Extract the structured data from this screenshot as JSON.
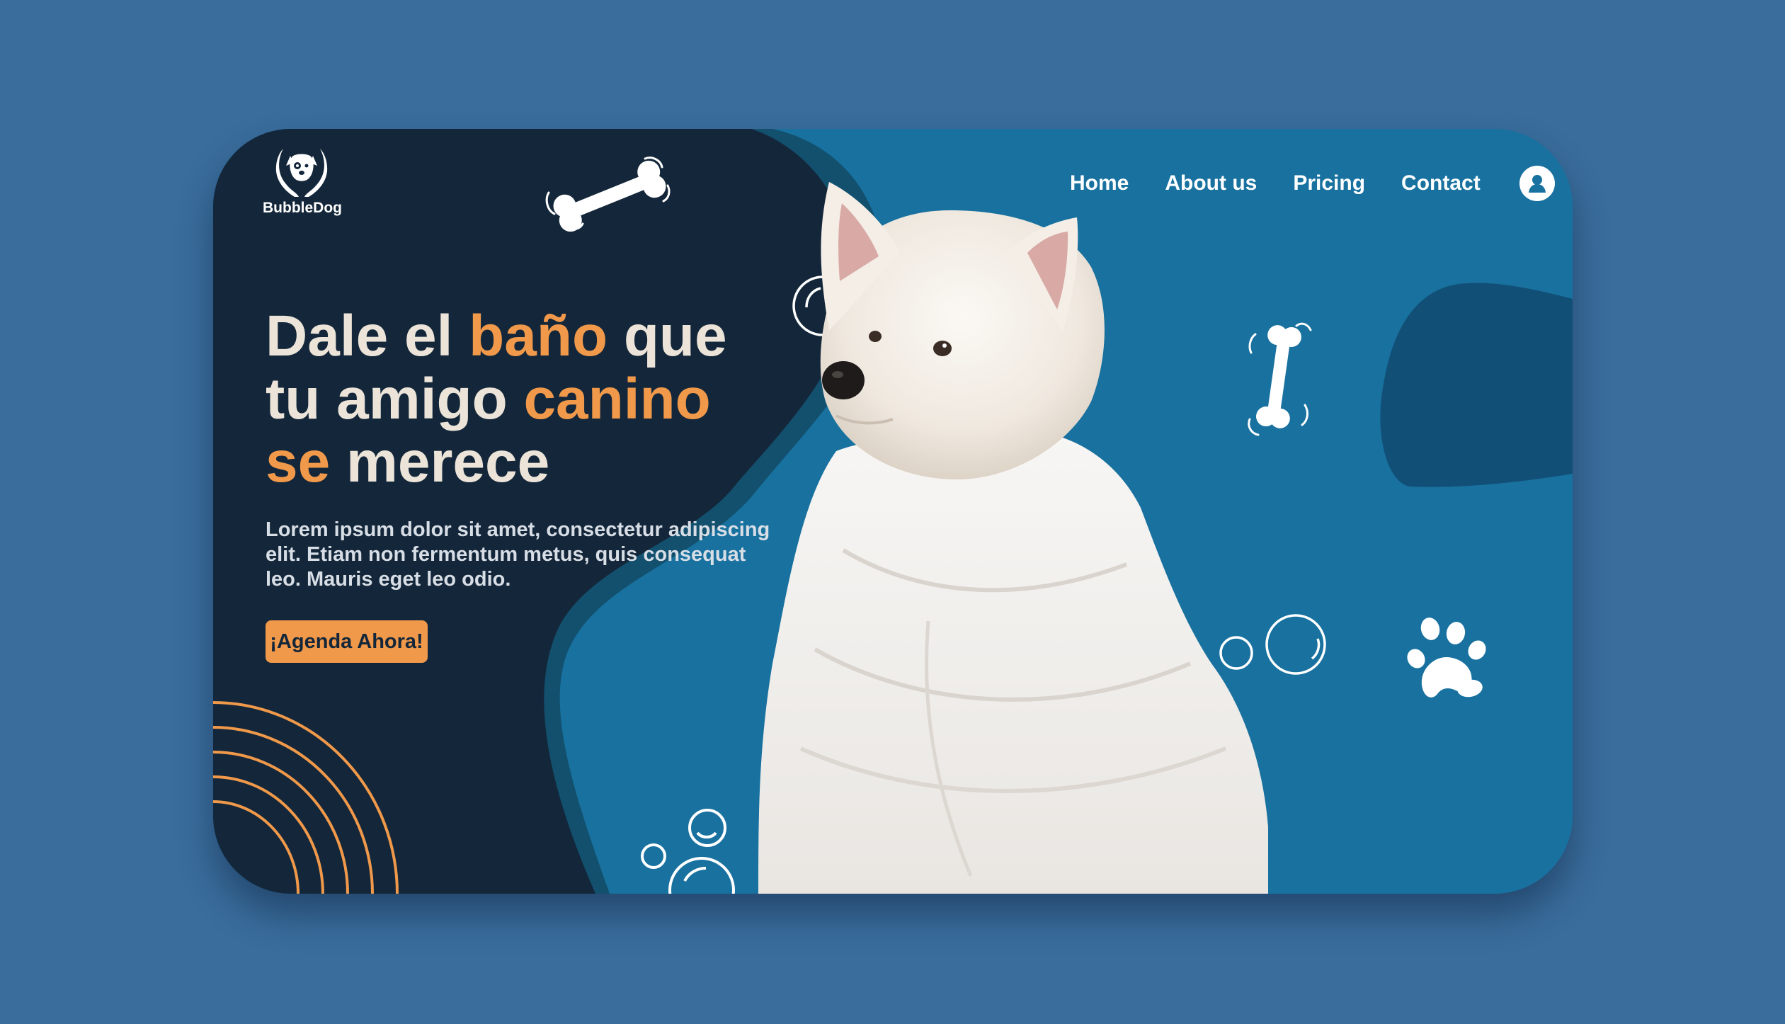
{
  "brand": {
    "name": "BubbleDog",
    "logo_icon": "dog-hands-logo-icon"
  },
  "nav": {
    "items": [
      {
        "label": "Home"
      },
      {
        "label": "About us"
      },
      {
        "label": "Pricing"
      },
      {
        "label": "Contact"
      }
    ],
    "user_icon": "user-avatar-icon"
  },
  "hero": {
    "headline": {
      "w1": "Dale el ",
      "w2": "baño",
      "w3": " que",
      "w4": "tu amigo ",
      "w5": "canino",
      "w6": "se",
      "w7": " merece"
    },
    "description": "Lorem ipsum dolor sit amet, consectetur adipiscing elit. Etiam non fermentum metus, quis consequat leo. Mauris eget leo odio.",
    "cta_label": "¡Agenda Ahora!"
  },
  "colors": {
    "page_background": "#3a6d9c",
    "dark_navy": "#14273a",
    "primary_blue": "#18719f",
    "accent_orange": "#f0994a",
    "headline_cream": "#ece4d9"
  },
  "decorations": [
    "bone-icon",
    "bubble-icon",
    "paw-print-icon",
    "concentric-arcs"
  ]
}
